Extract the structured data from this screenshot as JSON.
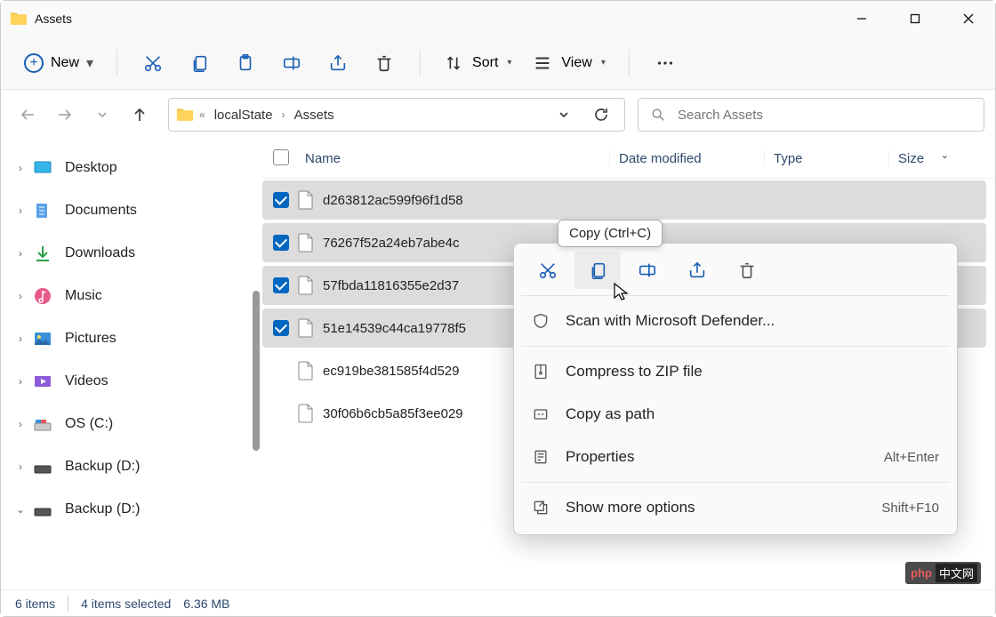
{
  "window": {
    "title": "Assets"
  },
  "toolbar": {
    "new_label": "New",
    "sort_label": "Sort",
    "view_label": "View"
  },
  "breadcrumb": {
    "seg1": "localState",
    "seg2": "Assets"
  },
  "search": {
    "placeholder": "Search Assets"
  },
  "sidebar": {
    "items": [
      {
        "label": "Desktop"
      },
      {
        "label": "Documents"
      },
      {
        "label": "Downloads"
      },
      {
        "label": "Music"
      },
      {
        "label": "Pictures"
      },
      {
        "label": "Videos"
      },
      {
        "label": "OS (C:)"
      },
      {
        "label": "Backup (D:)"
      },
      {
        "label": "Backup (D:)"
      }
    ]
  },
  "columns": {
    "name": "Name",
    "date": "Date modified",
    "type": "Type",
    "size": "Size"
  },
  "files": [
    {
      "name": "d263812ac599f96f1d58",
      "selected": true
    },
    {
      "name": "76267f52a24eb7abe4c",
      "selected": true
    },
    {
      "name": "57fbda11816355e2d37",
      "selected": true
    },
    {
      "name": "51e14539c44ca19778f5",
      "selected": true
    },
    {
      "name": "ec919be381585f4d529",
      "selected": false
    },
    {
      "name": "30f06b6cb5a85f3ee029",
      "selected": false
    }
  ],
  "tooltip": {
    "text": "Copy (Ctrl+C)"
  },
  "context": {
    "scan": "Scan with Microsoft Defender...",
    "zip": "Compress to ZIP file",
    "copypath": "Copy as path",
    "properties": "Properties",
    "properties_key": "Alt+Enter",
    "more": "Show more options",
    "more_key": "Shift+F10"
  },
  "status": {
    "count": "6 items",
    "selected": "4 items selected",
    "size": "6.36 MB"
  },
  "badge": {
    "p": "php",
    "cn": "中文网"
  }
}
